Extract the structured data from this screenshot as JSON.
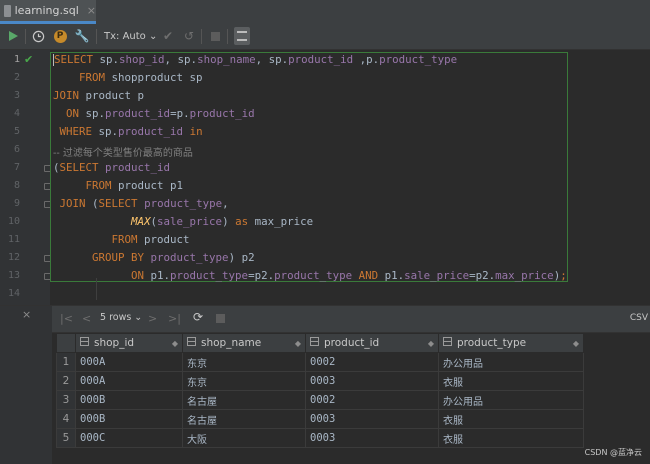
{
  "tab": {
    "filename": "learning.sql",
    "close_glyph": "×"
  },
  "toolbar": {
    "tx_mode": "Tx: Auto ⌄",
    "profile_letter": "P"
  },
  "editor": {
    "line_numbers": [
      "1",
      "2",
      "3",
      "4",
      "5",
      "6",
      "7",
      "8",
      "9",
      "10",
      "11",
      "12",
      "13",
      "14"
    ],
    "comment_line6": "-- 过滤每个类型售价最高的商品"
  },
  "results": {
    "close_glyph": "×",
    "rows_label": "5 rows ⌄",
    "export_label": "CSV",
    "columns": [
      "shop_id",
      "shop_name",
      "product_id",
      "product_type"
    ],
    "rows": [
      [
        "1",
        "000A",
        "东京",
        "0002",
        "办公用品"
      ],
      [
        "2",
        "000A",
        "东京",
        "0003",
        "衣服"
      ],
      [
        "3",
        "000B",
        "名古屋",
        "0002",
        "办公用品"
      ],
      [
        "4",
        "000B",
        "名古屋",
        "0003",
        "衣服"
      ],
      [
        "5",
        "000C",
        "大阪",
        "0003",
        "衣服"
      ]
    ]
  },
  "watermark": "CSDN @蓝净云",
  "colors": {
    "keyword": "#cc7832",
    "field": "#9876aa",
    "function": "#ffc66d",
    "comment": "#808080",
    "success": "#49a84b"
  }
}
